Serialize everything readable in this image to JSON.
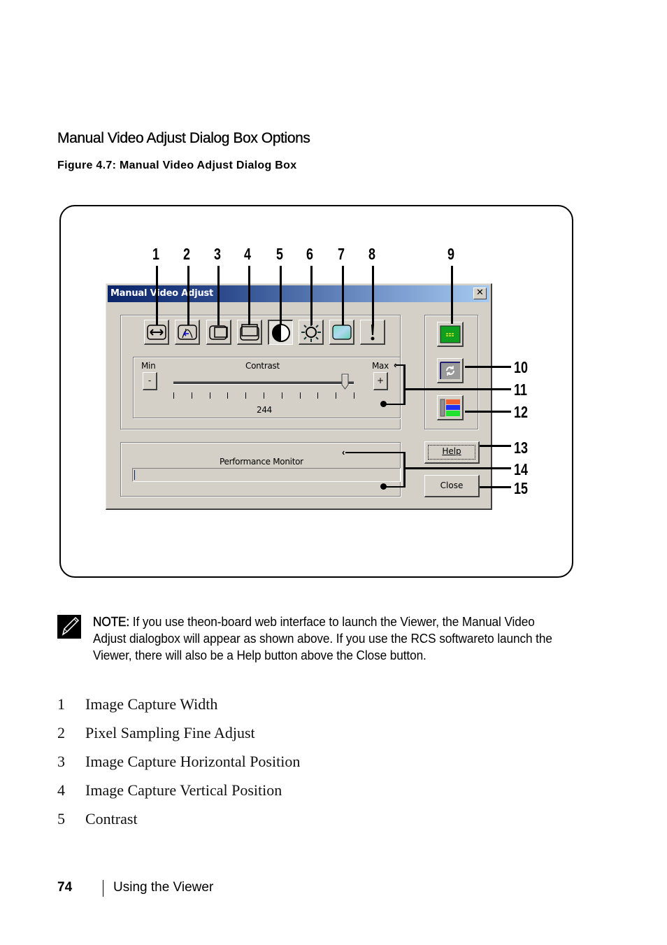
{
  "section_title": "Manual Video Adjust Dialog Box Options",
  "figure_caption": "Figure 4.7: Manual Video Adjust Dialog Box",
  "dialog": {
    "title": "Manual Video Adjust",
    "close_glyph": "✕",
    "toolbar_buttons": [
      {
        "callout": "1",
        "icon": "horizontal-arrow-icon",
        "pressed": false
      },
      {
        "callout": "2",
        "icon": "pixel-sampling-icon",
        "pressed": false
      },
      {
        "callout": "3",
        "icon": "horizontal-position-icon",
        "pressed": false
      },
      {
        "callout": "4",
        "icon": "vertical-position-icon",
        "pressed": false
      },
      {
        "callout": "5",
        "icon": "contrast-icon",
        "pressed": true
      },
      {
        "callout": "6",
        "icon": "brightness-sun-icon",
        "pressed": false
      },
      {
        "callout": "7",
        "icon": "noise-threshold-icon",
        "pressed": false
      },
      {
        "callout": "8",
        "icon": "exclamation-icon",
        "pressed": false
      }
    ],
    "side_buttons": [
      {
        "callout": "9",
        "icon": "auto-adjust-video-icon"
      },
      {
        "callout": "10",
        "icon": "refresh-image-icon"
      },
      {
        "callout": "12",
        "icon": "color-mode-icon"
      }
    ],
    "slider": {
      "min_label": "Min",
      "max_label": "Max",
      "title": "Contrast",
      "minus_label": "-",
      "plus_label": "+",
      "value_text": "244",
      "position_fraction": 0.96,
      "tick_count": 11
    },
    "performance_monitor": {
      "label": "Performance Monitor",
      "fill_fraction": 0.0
    },
    "help_label": "Help",
    "close_label": "Close",
    "callouts_right": [
      "10",
      "11",
      "12",
      "13",
      "14",
      "15"
    ]
  },
  "note": {
    "label": "NOTE:",
    "text": " If you use theon-board web interface to launch the Viewer, the Manual Video Adjust dialogbox will appear as shown above. If you use the RCS softwareto launch the Viewer, there will also be a Help button above the Close button."
  },
  "legend": [
    {
      "num": "1",
      "label": "Image Capture Width"
    },
    {
      "num": "2",
      "label": "Pixel Sampling Fine Adjust"
    },
    {
      "num": "3",
      "label": "Image Capture Horizontal Position"
    },
    {
      "num": "4",
      "label": "Image Capture Vertical Position"
    },
    {
      "num": "5",
      "label": "Contrast"
    }
  ],
  "footer": {
    "page_number": "74",
    "section": "Using the Viewer"
  }
}
